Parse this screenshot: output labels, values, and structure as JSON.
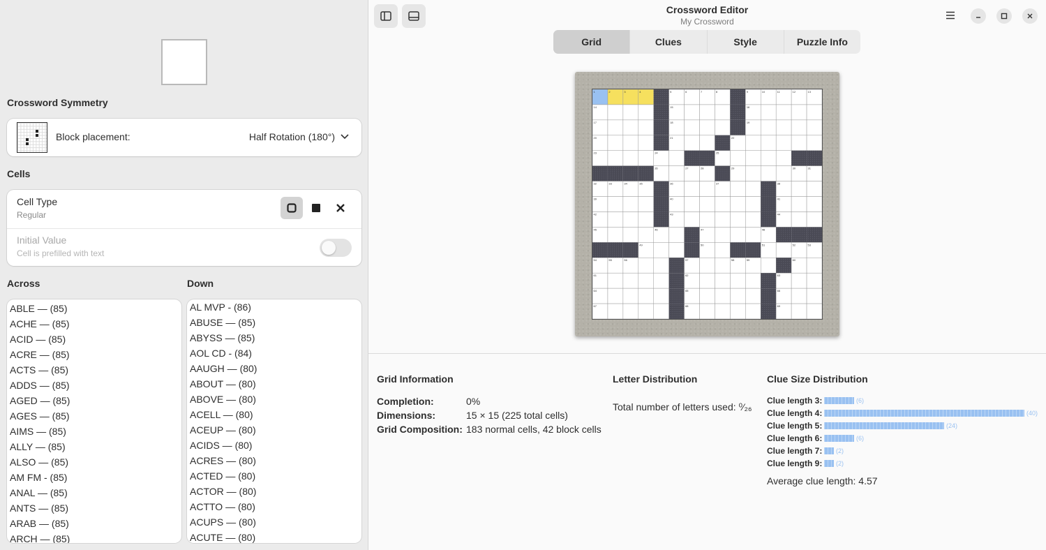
{
  "sidebar": {
    "symmetry_title": "Crossword Symmetry",
    "block_placement_label": "Block placement:",
    "block_placement_value": "Half Rotation (180°)",
    "cells_title": "Cells",
    "cell_type_label": "Cell Type",
    "cell_type_value": "Regular",
    "initial_value_label": "Initial Value",
    "initial_value_sub": "Cell is prefilled with text",
    "initial_value_on": false,
    "across_title": "Across",
    "down_title": "Down",
    "across": [
      "ABLE — (85)",
      "ACHE — (85)",
      "ACID — (85)",
      "ACRE — (85)",
      "ACTS — (85)",
      "ADDS — (85)",
      "AGED — (85)",
      "AGES — (85)",
      "AIMS — (85)",
      "ALLY — (85)",
      "ALSO — (85)",
      "AM FM - (85)",
      "ANAL — (85)",
      "ANTS — (85)",
      "ARAB — (85)",
      "ARCH — (85)"
    ],
    "down": [
      "AL MVP - (86)",
      "ABUSE — (85)",
      "ABYSS — (85)",
      "AOL CD - (84)",
      "AAUGH — (80)",
      "ABOUT — (80)",
      "ABOVE — (80)",
      "ACELL — (80)",
      "ACEUP — (80)",
      "ACIDS — (80)",
      "ACRES — (80)",
      "ACTED — (80)",
      "ACTOR — (80)",
      "ACTTO — (80)",
      "ACUPS — (80)",
      "ACUTE — (80)"
    ]
  },
  "header": {
    "title": "Crossword Editor",
    "subtitle": "My Crossword",
    "tabs": [
      "Grid",
      "Clues",
      "Style",
      "Puzzle Info"
    ],
    "active_tab": "Grid"
  },
  "grid": {
    "size": 15,
    "rows": [
      "....#....#.....",
      "....#....#.....",
      "....#....#.....",
      "....#...#......",
      "......##.....##",
      "####....#......",
      "....#......#...",
      "....#......#...",
      "....#......#...",
      "......#.....###",
      "###...#..##....",
      ".....#......#..",
      ".....#.....#...",
      ".....#.....#...",
      ".....#.....#..."
    ],
    "selected_cell": [
      0,
      0
    ],
    "highlighted_cells": [
      [
        0,
        1
      ],
      [
        0,
        2
      ],
      [
        0,
        3
      ]
    ],
    "colors": {
      "selected": "#99c1f1",
      "highlight": "#f6e05e",
      "block": "#4a4a55"
    }
  },
  "info": {
    "grid_info_title": "Grid Information",
    "completion_label": "Completion:",
    "completion_value": "0%",
    "dimensions_label": "Dimensions:",
    "dimensions_value": "15 × 15 (225 total cells)",
    "composition_label": "Grid Composition:",
    "composition_value": "183 normal cells, 42 block cells",
    "letter_title": "Letter Distribution",
    "letters_used": "Total number of letters used: ⁰⁄₂₆",
    "clue_title": "Clue Size Distribution",
    "clue_sizes": [
      {
        "label": "Clue length 3:",
        "count": 6,
        "count_text": "(6)"
      },
      {
        "label": "Clue length 4:",
        "count": 40,
        "count_text": "(40)"
      },
      {
        "label": "Clue length 5:",
        "count": 24,
        "count_text": "(24)"
      },
      {
        "label": "Clue length 6:",
        "count": 6,
        "count_text": "(6)"
      },
      {
        "label": "Clue length 7:",
        "count": 2,
        "count_text": "(2)"
      },
      {
        "label": "Clue length 9:",
        "count": 2,
        "count_text": "(2)"
      }
    ],
    "average": "Average clue length: 4.57"
  }
}
